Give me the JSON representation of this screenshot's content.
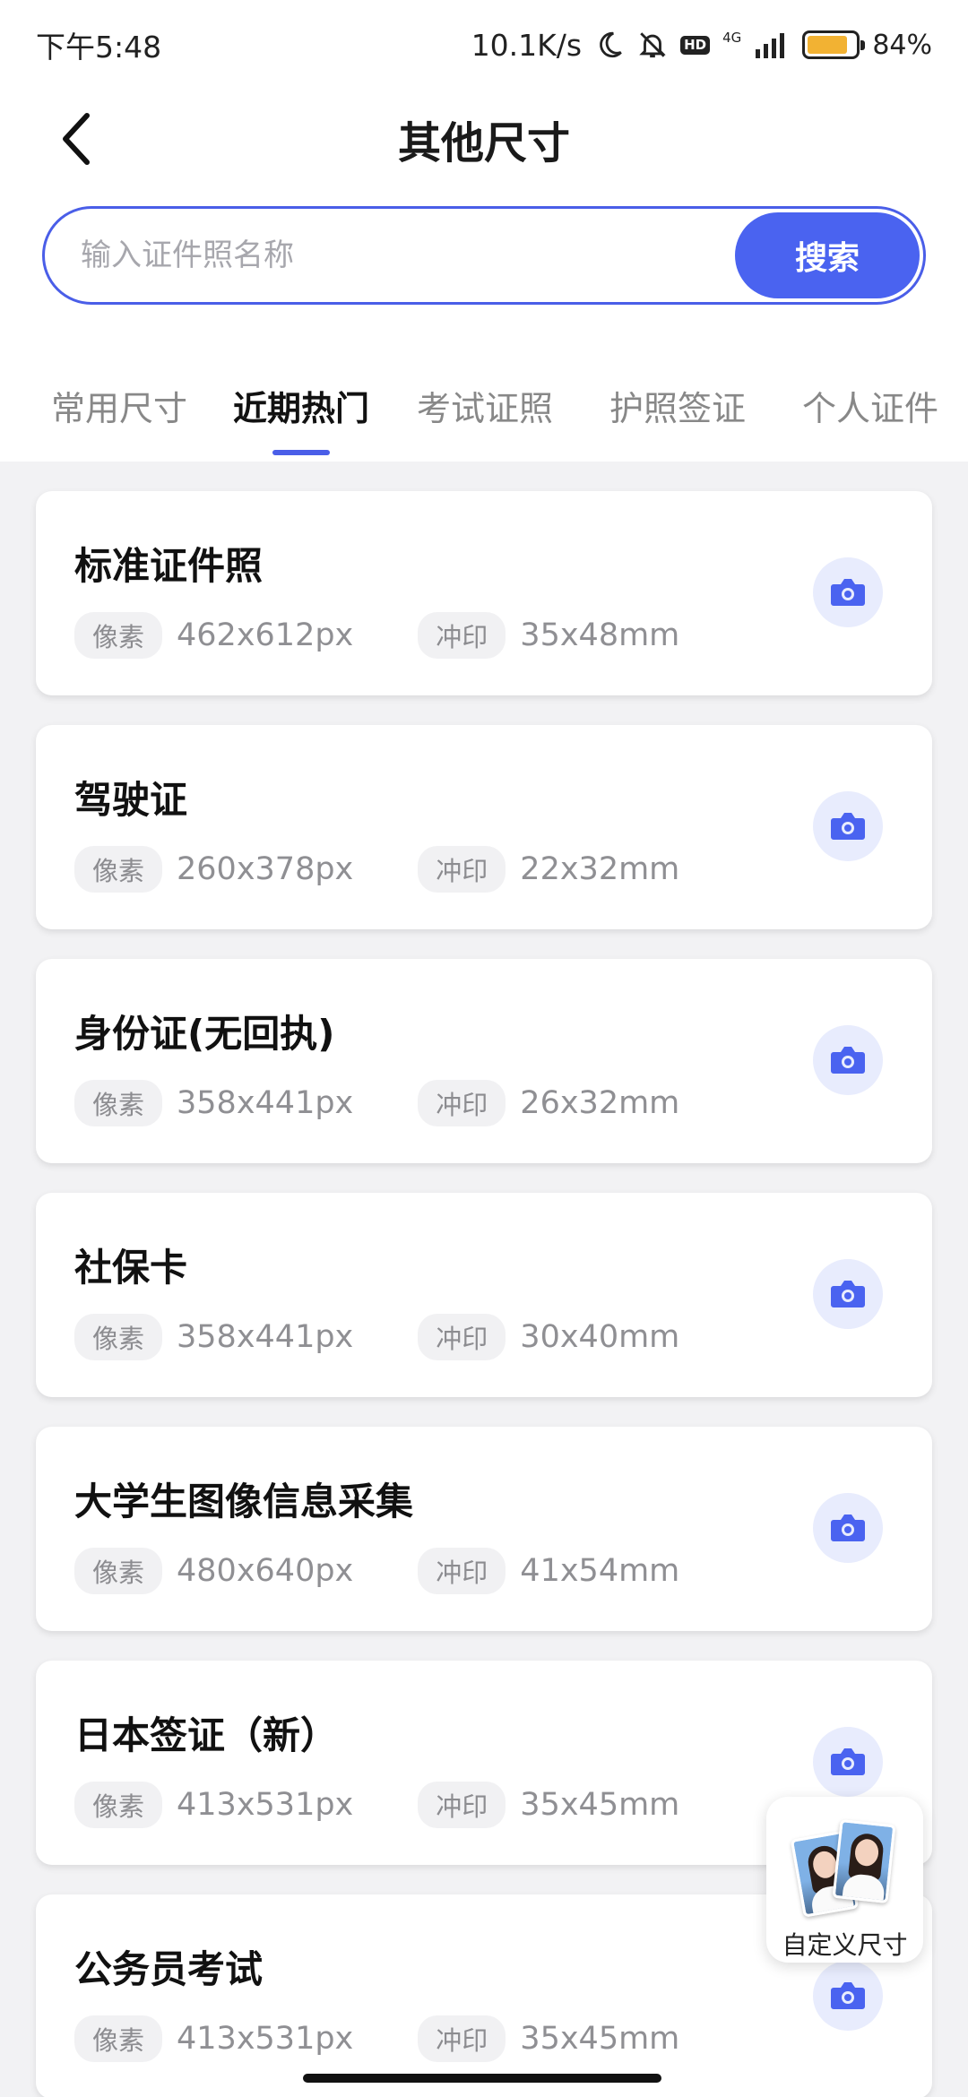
{
  "status_bar": {
    "time": "下午5:48",
    "net_speed": "10.1K/s",
    "hd": "HD",
    "network": "4G",
    "battery": "84%",
    "battery_level": 0.84
  },
  "header": {
    "title": "其他尺寸"
  },
  "search": {
    "placeholder": "输入证件照名称",
    "value": "",
    "button_label": "搜索"
  },
  "tabs": [
    {
      "label": "常用尺寸",
      "active": false
    },
    {
      "label": "近期热门",
      "active": true
    },
    {
      "label": "考试证照",
      "active": false
    },
    {
      "label": "护照签证",
      "active": false
    },
    {
      "label": "个人证件",
      "active": false
    }
  ],
  "cards": [
    {
      "title": "标准证件照",
      "pixel_label": "像素",
      "pixel": "462x612px",
      "print_label": "冲印",
      "print": "35x48mm"
    },
    {
      "title": "驾驶证",
      "pixel_label": "像素",
      "pixel": "260x378px",
      "print_label": "冲印",
      "print": "22x32mm"
    },
    {
      "title": "身份证(无回执)",
      "pixel_label": "像素",
      "pixel": "358x441px",
      "print_label": "冲印",
      "print": "26x32mm"
    },
    {
      "title": "社保卡",
      "pixel_label": "像素",
      "pixel": "358x441px",
      "print_label": "冲印",
      "print": "30x40mm"
    },
    {
      "title": "大学生图像信息采集",
      "pixel_label": "像素",
      "pixel": "480x640px",
      "print_label": "冲印",
      "print": "41x54mm"
    },
    {
      "title": "日本签证（新）",
      "pixel_label": "像素",
      "pixel": "413x531px",
      "print_label": "冲印",
      "print": "35x45mm"
    },
    {
      "title": "公务员考试",
      "pixel_label": "像素",
      "pixel": "413x531px",
      "print_label": "冲印",
      "print": "35x45mm"
    }
  ],
  "custom_size": {
    "label": "自定义尺寸"
  },
  "colors": {
    "accent": "#4a5ee8",
    "search_button": "#4a63f0",
    "camera_bg": "#e8ecfd",
    "page_bg": "#f2f2f4"
  }
}
